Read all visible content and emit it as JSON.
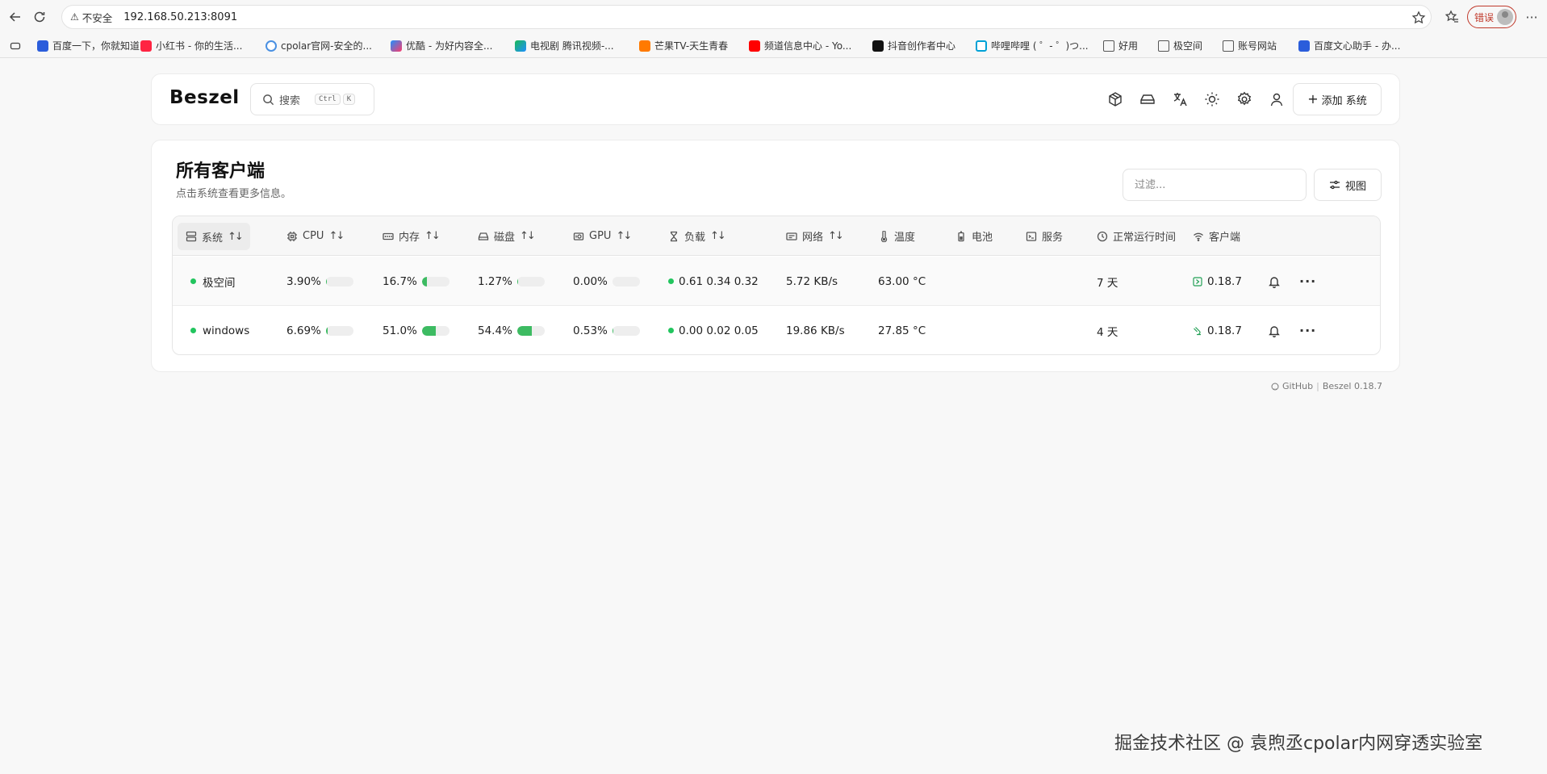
{
  "browser": {
    "insecure_label": "不安全",
    "url": "192.168.50.213:8091",
    "error_label": "错误",
    "bookmarks": [
      {
        "label": "百度一下，你就知道",
        "color": "#2b5ddb"
      },
      {
        "label": "小红书 - 你的生活...",
        "color": "#ff2442"
      },
      {
        "label": "cpolar官网-安全的...",
        "color": "#4a90e2"
      },
      {
        "label": "优酷 - 为好内容全...",
        "color": "#1f8fff"
      },
      {
        "label": "电视剧 腾讯视频-...",
        "color": "#19b955"
      },
      {
        "label": "芒果TV-天生青春",
        "color": "#ff7a00"
      },
      {
        "label": "频道信息中心 - Yo...",
        "color": "#ff0000"
      },
      {
        "label": "抖音创作者中心",
        "color": "#111111"
      },
      {
        "label": "哔哩哔哩 ( ゜- ゜)つ...",
        "color": "#00a1d6"
      },
      {
        "label": "好用",
        "color": "#777777"
      },
      {
        "label": "极空间",
        "color": "#777777"
      },
      {
        "label": "账号网站",
        "color": "#777777"
      },
      {
        "label": "百度文心助手 - 办...",
        "color": "#2b5ddb"
      }
    ]
  },
  "header": {
    "logo": "Beszel",
    "search_label": "搜索",
    "kbd1": "Ctrl",
    "kbd2": "K",
    "add_button": "添加 系统"
  },
  "main": {
    "title": "所有客户端",
    "subtitle": "点击系统查看更多信息。",
    "filter_placeholder": "过滤...",
    "view_button": "视图",
    "columns": {
      "system": "系统",
      "cpu": "CPU",
      "memory": "内存",
      "disk": "磁盘",
      "gpu": "GPU",
      "load": "负载",
      "network": "网络",
      "temp": "温度",
      "battery": "电池",
      "services": "服务",
      "uptime": "正常运行时间",
      "agent": "客户端"
    },
    "rows": [
      {
        "name": "极空间",
        "cpu": "3.90%",
        "cpu_pct": 3.9,
        "mem": "16.7%",
        "mem_pct": 16.7,
        "disk": "1.27%",
        "disk_pct": 1.27,
        "gpu": "0.00%",
        "gpu_pct": 0,
        "load": "0.61 0.34 0.32",
        "net": "5.72 KB/s",
        "temp": "63.00 °C",
        "uptime": "7 天",
        "agent": "0.18.7"
      },
      {
        "name": "windows",
        "cpu": "6.69%",
        "cpu_pct": 6.69,
        "mem": "51.0%",
        "mem_pct": 51.0,
        "disk": "54.4%",
        "disk_pct": 54.4,
        "gpu": "0.53%",
        "gpu_pct": 0.53,
        "load": "0.00 0.02 0.05",
        "net": "19.86 KB/s",
        "temp": "27.85 °C",
        "uptime": "4 天",
        "agent": "0.18.7"
      }
    ]
  },
  "footer": {
    "github": "GitHub",
    "version": "Beszel 0.18.7"
  },
  "watermark": "掘金技术社区 @ 袁煦丞cpolar内网穿透实验室",
  "colors": {
    "accent_green": "#3dbb62",
    "status_dot": "#22c55e"
  }
}
